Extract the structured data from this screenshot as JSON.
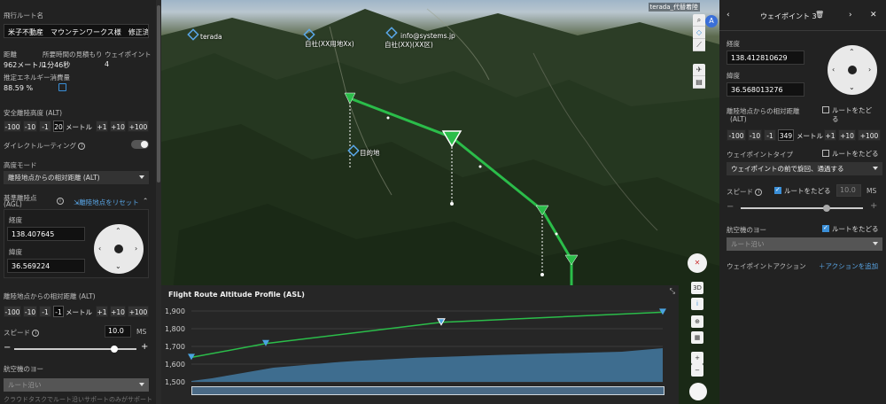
{
  "left": {
    "route_name_label": "飛行ルート名",
    "route_name_value": "米子不動産　マウンテンワークス様　修正済み",
    "distance_label": "距離",
    "distance_value": "962メートル",
    "time_label": "所要時間の見積もり",
    "time_value": "1分46秒",
    "waypoint_label": "ウェイポイント",
    "waypoint_value": "4",
    "energy_label": "推定エネルギー消費量",
    "energy_value": "88.59 %",
    "safe_alt_label": "安全離陸高度 (ALT)",
    "safe_alt_value": "20",
    "unit_meter": "メートル",
    "btn_m100": "-100",
    "btn_m10": "-10",
    "btn_m1": "-1",
    "btn_p1": "+1",
    "btn_p10": "+10",
    "btn_p100": "+100",
    "direct_routing_label": "ダイレクトルーティング",
    "alt_mode_label": "高度モード",
    "alt_mode_value": "離陸地点からの相対距離 (ALT)",
    "base_point_label": "基準離陸点\n(AGL)",
    "base_point_label_1": "基準離陸点",
    "base_point_label_2": "(AGL)",
    "reset_label": "離陸地点をリセット",
    "lon_label": "経度",
    "lon_value": "138.407645",
    "lat_label": "緯度",
    "lat_value": "36.569224",
    "rel_alt_label": "離陸地点からの相対距離 (ALT)",
    "rel_alt_value": "-1",
    "speed_label": "スピード",
    "speed_value": "10.0",
    "speed_unit": "MS",
    "speed_fraction": 0.82,
    "yaw_label": "航空機のヨー",
    "yaw_value": "ルート沿い",
    "footer_note": "クラウドタスクでルート沿いサポートのみがサポート"
  },
  "map": {
    "labels": {
      "terada": "terada",
      "city_hall": "自社(XX用地Xx)",
      "info": "info@systems.jp",
      "lake": "自社(XX)(XX区)",
      "eye": "目的地"
    },
    "top_right_label": "terada_代替着陸",
    "btn_3d": "3D",
    "zoom_in": "+",
    "zoom_out": "−"
  },
  "profile": {
    "title": "Flight Route Altitude Profile (ASL)",
    "close": "⤡",
    "yticks": [
      "1,900",
      "1,800",
      "1,700",
      "1,600",
      "1,500"
    ],
    "route_alt": [
      1638,
      1716,
      1836,
      1893
    ],
    "route_color": "#2bbd4a",
    "terrain_color": "#3e6d8f"
  },
  "right": {
    "title": "ウェイポイント 3",
    "lon_label": "経度",
    "lon_value": "138.412810629",
    "lat_label": "緯度",
    "lat_value": "36.568013276",
    "rel_alt_label_1": "離陸地点からの相対距離",
    "rel_alt_label_2": "(ALT)",
    "follow_route": "ルートをたど",
    "follow_route_2": "る",
    "alt_value": "349",
    "unit_meter": "メートル",
    "btn_m100": "-100",
    "btn_m10": "-10",
    "btn_m1": "-1",
    "btn_p1": "+1",
    "btn_p10": "+10",
    "btn_p100": "+100",
    "wp_type_label": "ウェイポイントタイプ",
    "wp_type_follow": "ルートをたどる",
    "wp_type_value": "ウェイポイントの前で旋回、通過する",
    "speed_label": "スピード",
    "speed_follow": "ルートをたどる",
    "speed_value": "10.0",
    "speed_unit": "MS",
    "speed_fraction": 0.7,
    "yaw_label": "航空機のヨー",
    "yaw_follow": "ルートをたどる",
    "yaw_value": "ルート沿い",
    "action_label": "ウェイポイントアクション",
    "add_action": "アクションを追加"
  }
}
